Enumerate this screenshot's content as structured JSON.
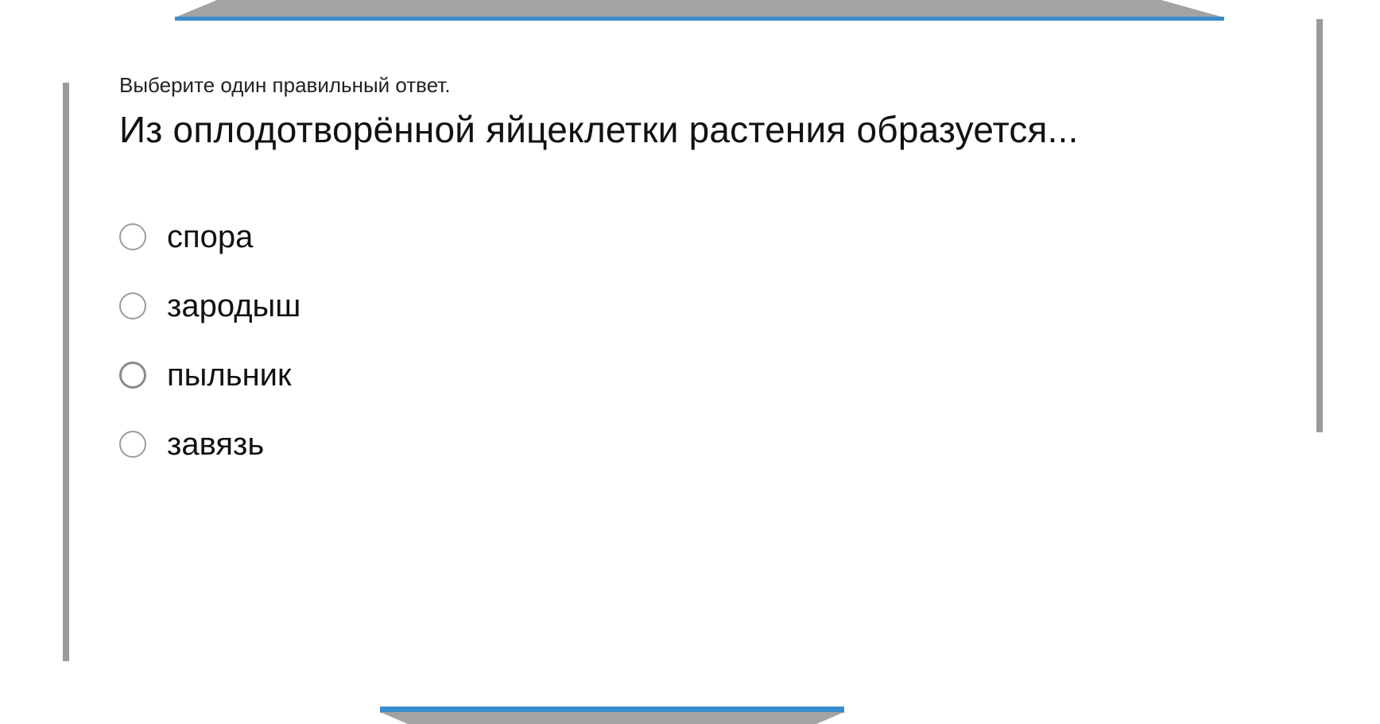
{
  "quiz": {
    "instruction": "Выберите один правильный ответ.",
    "question": "Из оплодотворённой яйцеклетки растения образуется...",
    "options": [
      {
        "label": "спора",
        "selected": false
      },
      {
        "label": "зародыш",
        "selected": false
      },
      {
        "label": "пыльник",
        "selected": false
      },
      {
        "label": "завязь",
        "selected": false
      }
    ]
  },
  "colors": {
    "accent": "#3a8ccc",
    "frame_shadow": "#9a9a9a",
    "radio_border": "#9c9c9c"
  }
}
